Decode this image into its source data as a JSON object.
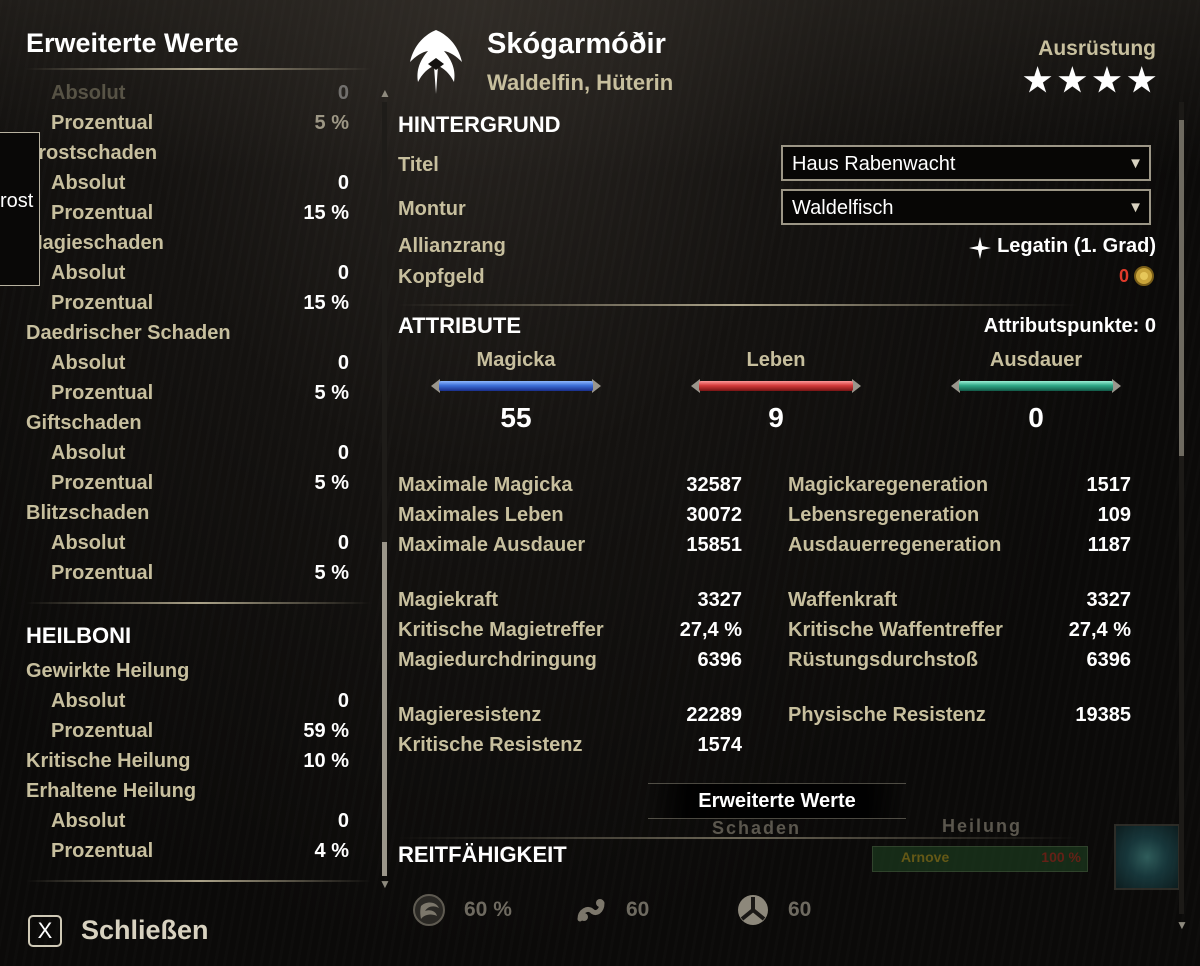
{
  "left_panel": {
    "title": "Erweiterte Werte",
    "faded_row": {
      "label": "Absolut",
      "value": "0"
    },
    "first_row": {
      "label": "Prozentual",
      "value": "5 %"
    },
    "groups": [
      {
        "name": "Frostschaden",
        "abs_label": "Absolut",
        "abs": "0",
        "pct_label": "Prozentual",
        "pct": "15 %"
      },
      {
        "name": "Magieschaden",
        "abs_label": "Absolut",
        "abs": "0",
        "pct_label": "Prozentual",
        "pct": "15 %"
      },
      {
        "name": "Daedrischer Schaden",
        "abs_label": "Absolut",
        "abs": "0",
        "pct_label": "Prozentual",
        "pct": "5 %"
      },
      {
        "name": "Giftschaden",
        "abs_label": "Absolut",
        "abs": "0",
        "pct_label": "Prozentual",
        "pct": "5 %"
      },
      {
        "name": "Blitzschaden",
        "abs_label": "Absolut",
        "abs": "0",
        "pct_label": "Prozentual",
        "pct": "5 %"
      }
    ],
    "heal_title": "HEILBONI",
    "heal": {
      "gewirkt": {
        "name": "Gewirkte Heilung",
        "abs_label": "Absolut",
        "abs": "0",
        "pct_label": "Prozentual",
        "pct": "59 %"
      },
      "kritisch": {
        "name": "Kritische Heilung",
        "value": "10 %"
      },
      "erhalten": {
        "name": "Erhaltene Heilung",
        "abs_label": "Absolut",
        "abs": "0",
        "pct_label": "Prozentual",
        "pct": "4 %"
      }
    },
    "tooltip_text": "rost"
  },
  "header": {
    "name": "Skógarmóðir",
    "subtitle": "Waldelfin, Hüterin",
    "equipment_label": "Ausrüstung",
    "stars": [
      "★",
      "★",
      "★",
      "★"
    ],
    "equipment_stars": 4
  },
  "background": {
    "title": "HINTERGRUND",
    "titel_label": "Titel",
    "titel_value": "Haus Rabenwacht",
    "montur_label": "Montur",
    "montur_value": "Waldelfisch",
    "rank_label": "Allianzrang",
    "rank_value": "Legatin (1. Grad)",
    "bounty_label": "Kopfgeld",
    "bounty_value": "0"
  },
  "attributes": {
    "title": "ATTRIBUTE",
    "points_label": "Attributspunkte: 0",
    "magicka": {
      "label": "Magicka",
      "value": "55",
      "color": "#3d6fd8"
    },
    "leben": {
      "label": "Leben",
      "value": "9",
      "color": "#d43b3b"
    },
    "ausdauer": {
      "label": "Ausdauer",
      "value": "0",
      "color": "#2fa887"
    }
  },
  "stats": {
    "left": [
      {
        "label": "Maximale Magicka",
        "value": "32587"
      },
      {
        "label": "Maximales Leben",
        "value": "30072"
      },
      {
        "label": "Maximale Ausdauer",
        "value": "15851"
      },
      {
        "label": "Magiekraft",
        "value": "3327"
      },
      {
        "label": "Kritische Magietreffer",
        "value": "27,4 %"
      },
      {
        "label": "Magiedurchdringung",
        "value": "6396"
      },
      {
        "label": "Magieresistenz",
        "value": "22289"
      },
      {
        "label": "Kritische Resistenz",
        "value": "1574"
      }
    ],
    "right": [
      {
        "label": "Magickaregeneration",
        "value": "1517"
      },
      {
        "label": "Lebensregeneration",
        "value": "109"
      },
      {
        "label": "Ausdauerregeneration",
        "value": "1187"
      },
      {
        "label": "Waffenkraft",
        "value": "3327"
      },
      {
        "label": "Kritische Waffentreffer",
        "value": "27,4 %"
      },
      {
        "label": "Rüstungsdurchstoß",
        "value": "6396"
      },
      {
        "label": "Physische Resistenz",
        "value": "19385"
      }
    ]
  },
  "advanced_button": "Erweiterte Werte",
  "ghost_tabs": {
    "left": "Schaden",
    "right": "Heilung"
  },
  "mini_bar": {
    "left": "Arnove",
    "right": "100 %"
  },
  "riding": {
    "title": "REITFÄHIGKEIT",
    "speed": "60 %",
    "capacity": "60",
    "stamina": "60"
  },
  "close": {
    "key": "X",
    "label": "Schließen"
  },
  "colors": {
    "gold": "#c7bf9e",
    "bounty_red": "#e03a2a"
  }
}
